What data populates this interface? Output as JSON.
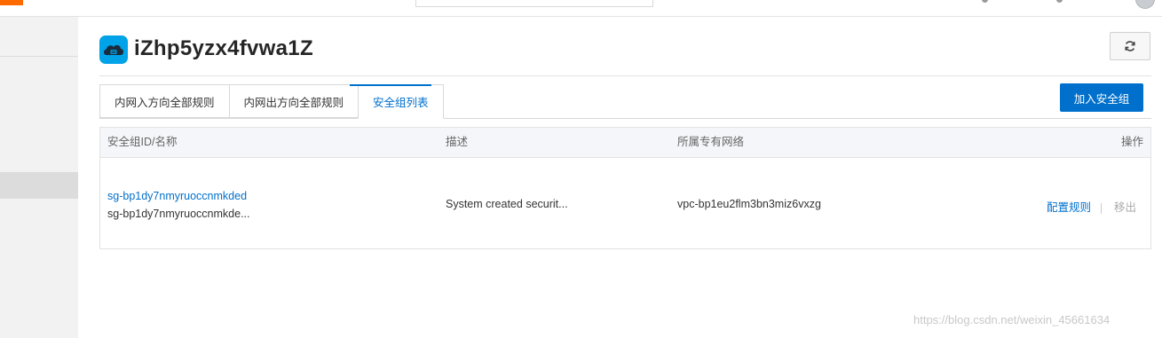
{
  "page": {
    "title": "iZhp5yzx4fvwa1Z",
    "refresh_icon": "refresh-icon",
    "instance_icon": "cloud-server-icon"
  },
  "tabs": [
    {
      "label": "内网入方向全部规则",
      "active": false
    },
    {
      "label": "内网出方向全部规则",
      "active": false
    },
    {
      "label": "安全组列表",
      "active": true
    }
  ],
  "actions": {
    "join_label": "加入安全组"
  },
  "table": {
    "headers": [
      "安全组ID/名称",
      "描述",
      "所属专有网络",
      "操作"
    ],
    "rows": [
      {
        "id": "sg-bp1dy7nmyruoccnmkded",
        "name": "sg-bp1dy7nmyruoccnmkde...",
        "description": "System created securit...",
        "vpc": "vpc-bp1eu2flm3bn3miz6vxzg",
        "op_configure": "配置规则",
        "op_remove": "移出"
      }
    ]
  },
  "watermark": "https://blog.csdn.net/weixin_45661634",
  "colors": {
    "accent": "#0070cc",
    "brand": "#ff6a00",
    "icon_blue": "#00a2e8"
  }
}
